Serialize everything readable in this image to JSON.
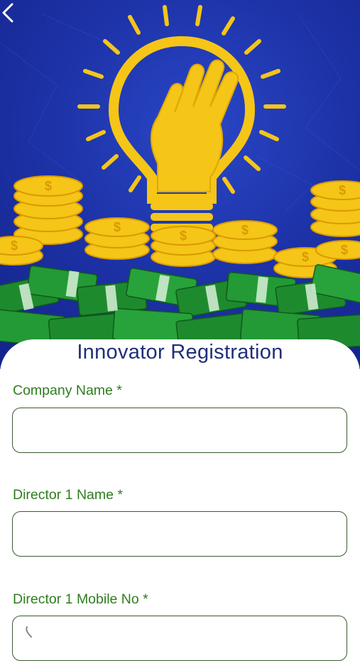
{
  "header": {
    "back_icon": "chevron-left-icon",
    "banner_icon": "lightbulb-hand-money-illustration"
  },
  "form": {
    "title": "Innovator Registration",
    "fields": [
      {
        "label": "Company Name *",
        "value": "",
        "placeholder": ""
      },
      {
        "label": "Director 1 Name *",
        "value": "",
        "placeholder": ""
      },
      {
        "label": "Director 1 Mobile No *",
        "value": "",
        "placeholder": "",
        "icon": "phone-icon"
      }
    ]
  },
  "colors": {
    "banner_blue": "#1d33a8",
    "title": "#1f2f7a",
    "label_green": "#2f7d1e",
    "field_border": "#3a5a30",
    "coin_gold": "#f5c518",
    "cash_green": "#1e8a2e"
  }
}
